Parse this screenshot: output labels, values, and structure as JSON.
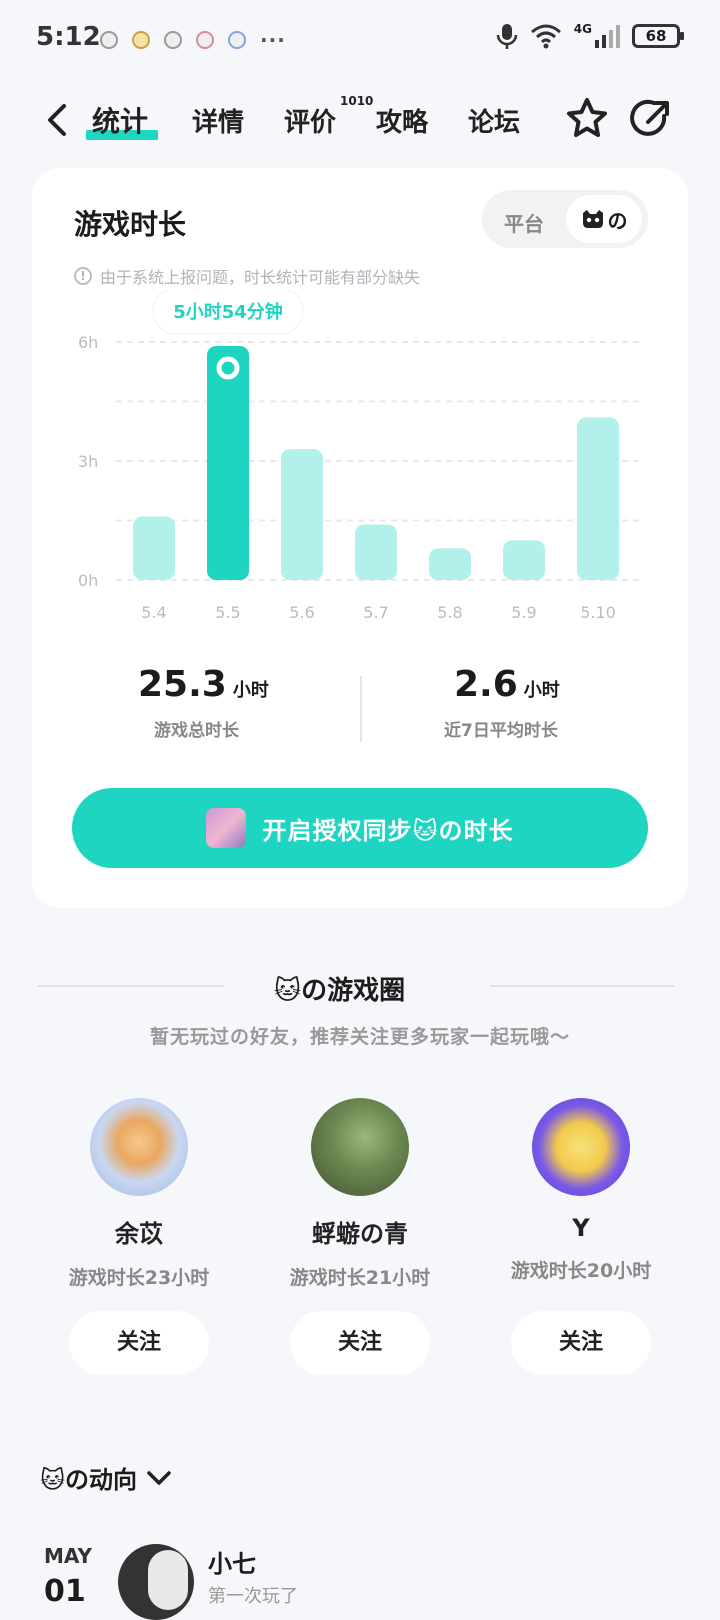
{
  "status_bar": {
    "time": "5:12",
    "more": "···",
    "network": "4G",
    "battery": "68"
  },
  "header": {
    "tabs": [
      {
        "label": "统计",
        "active": true
      },
      {
        "label": "详情"
      },
      {
        "label": "评价"
      },
      {
        "label": "攻略"
      },
      {
        "label": "论坛"
      }
    ],
    "review_count": "1010"
  },
  "card": {
    "title": "游戏时长",
    "toggle": {
      "platform": "平台",
      "selected": "🐱の"
    },
    "note": "由于系统上报问题，时长统计可能有部分缺失",
    "tooltip": "5小时54分钟",
    "stats": [
      {
        "value": "25.3",
        "unit": "小时",
        "label": "游戏总时长"
      },
      {
        "value": "2.6",
        "unit": "小时",
        "label": "近7日平均时长"
      }
    ],
    "cta": "开启授权同步🐱の时长"
  },
  "chart_data": {
    "type": "bar",
    "categories": [
      "5.4",
      "5.5",
      "5.6",
      "5.7",
      "5.8",
      "5.9",
      "5.10"
    ],
    "values": [
      1.6,
      5.9,
      3.3,
      1.4,
      0.8,
      1.0,
      4.1
    ],
    "y_ticks": [
      "0h",
      "3h",
      "6h"
    ],
    "ylim": [
      0,
      6
    ],
    "highlight_index": 1,
    "colors": {
      "bar": "#b2f1eb",
      "highlight": "#1ed5c1",
      "grid": "#e6e8eb",
      "tick": "#b9bcc1"
    }
  },
  "circle_section": {
    "title": "🐱の游戏圈",
    "subtitle": "暂无玩过の好友，推荐关注更多玩家一起玩哦～",
    "friends": [
      {
        "name": "余苡",
        "hours": "游戏时长23小时",
        "follow": "关注"
      },
      {
        "name": "蜉蝣の青",
        "hours": "游戏时长21小时",
        "follow": "关注"
      },
      {
        "name": "Y",
        "hours": "游戏时长20小时",
        "follow": "关注"
      }
    ]
  },
  "dynamics": {
    "title": "🐱の动向",
    "date_month": "MAY",
    "date_day": "01",
    "first_post_name": "小七",
    "first_post_sub": "第一次玩了"
  },
  "colors": {
    "accent": "#1ed5c1",
    "background": "#f5f7fa"
  }
}
